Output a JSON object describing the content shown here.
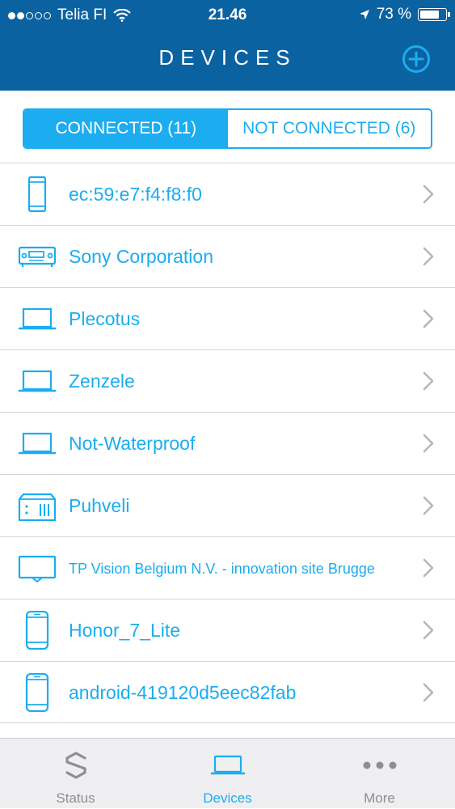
{
  "status_bar": {
    "carrier": "Telia FI",
    "time": "21.46",
    "battery": "73 %",
    "signal_bars": 2,
    "signal_total": 5
  },
  "header": {
    "title": "DEVICES",
    "add_icon": "plus-circle-icon"
  },
  "segment": {
    "connected": "CONNECTED (11)",
    "not_connected": "NOT CONNECTED (6)"
  },
  "devices": [
    {
      "name": "ec:59:e7:f4:f8:f0",
      "icon": "tablet-icon"
    },
    {
      "name": "Sony Corporation",
      "icon": "av-receiver-icon"
    },
    {
      "name": "Plecotus",
      "icon": "laptop-icon"
    },
    {
      "name": "Zenzele",
      "icon": "laptop-icon"
    },
    {
      "name": "Not-Waterproof",
      "icon": "laptop-icon"
    },
    {
      "name": "Puhveli",
      "icon": "nas-icon"
    },
    {
      "name": "TP Vision Belgium N.V. - innovation site Brugge",
      "icon": "tv-icon"
    },
    {
      "name": "Honor_7_Lite",
      "icon": "smartphone-icon"
    },
    {
      "name": "android-419120d5eec82fab",
      "icon": "smartphone-icon"
    }
  ],
  "tabbar": {
    "status": "Status",
    "devices": "Devices",
    "more": "More"
  },
  "colors": {
    "header_bg": "#0b62a0",
    "accent": "#1badf0",
    "tab_inactive": "#8e8e93",
    "tabbar_bg": "#efeff1"
  }
}
